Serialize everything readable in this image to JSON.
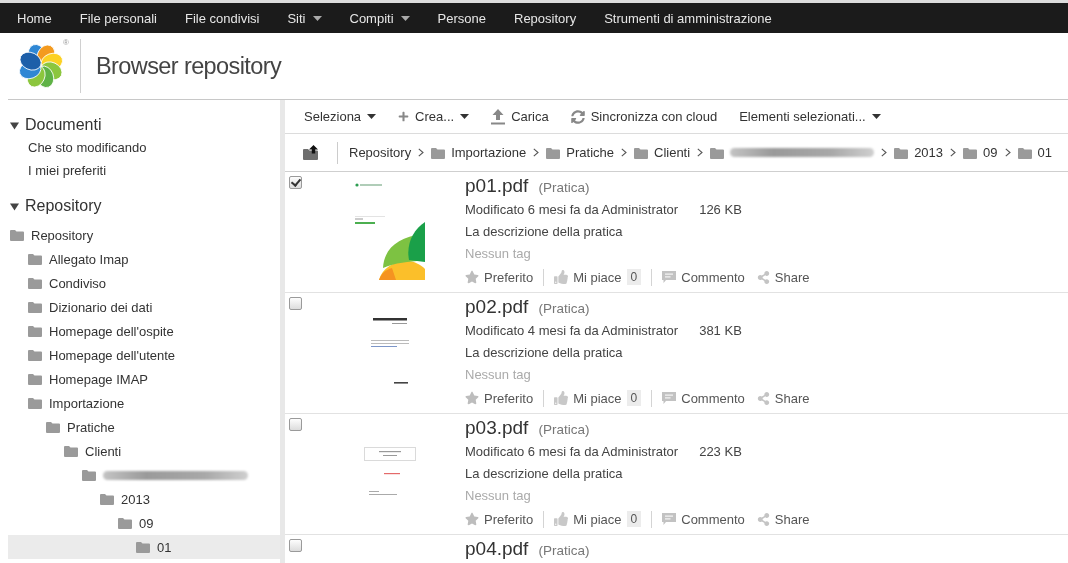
{
  "nav": {
    "items": [
      {
        "label": "Home",
        "dropdown": false
      },
      {
        "label": "File personali",
        "dropdown": false
      },
      {
        "label": "File condivisi",
        "dropdown": false
      },
      {
        "label": "Siti",
        "dropdown": true
      },
      {
        "label": "Compiti",
        "dropdown": true
      },
      {
        "label": "Persone",
        "dropdown": false
      },
      {
        "label": "Repository",
        "dropdown": false
      },
      {
        "label": "Strumenti di amministrazione",
        "dropdown": false
      }
    ]
  },
  "header": {
    "logo_mark": "®",
    "title": "Browser repository"
  },
  "sidebar": {
    "documents": {
      "title": "Documenti",
      "expanded": true,
      "links": [
        {
          "label": "Che sto modificando"
        },
        {
          "label": "I miei preferiti"
        }
      ]
    },
    "repository": {
      "title": "Repository",
      "expanded": true,
      "tree": [
        {
          "kind": "folder",
          "label": "Repository",
          "selected": false,
          "children": [
            {
              "kind": "folder",
              "label": "Allegato Imap",
              "selected": false
            },
            {
              "kind": "folder",
              "label": "Condiviso",
              "selected": false
            },
            {
              "kind": "folder",
              "label": "Dizionario dei dati",
              "selected": false
            },
            {
              "kind": "folder",
              "label": "Homepage dell'ospite",
              "selected": false
            },
            {
              "kind": "folder",
              "label": "Homepage dell'utente",
              "selected": false
            },
            {
              "kind": "folder",
              "label": "Homepage IMAP",
              "selected": false
            },
            {
              "kind": "folder",
              "label": "Importazione",
              "selected": false,
              "children": [
                {
                  "kind": "folder",
                  "label": "Pratiche",
                  "selected": false,
                  "children": [
                    {
                      "kind": "folder",
                      "label": "Clienti",
                      "selected": false,
                      "children": [
                        {
                          "kind": "redacted",
                          "selected": false,
                          "children": [
                            {
                              "kind": "folder",
                              "label": "2013",
                              "selected": false,
                              "children": [
                                {
                                  "kind": "folder",
                                  "label": "09",
                                  "selected": false,
                                  "children": [
                                    {
                                      "kind": "folder",
                                      "label": "01",
                                      "selected": true
                                    }
                                  ]
                                }
                              ]
                            }
                          ]
                        }
                      ]
                    }
                  ]
                }
              ]
            }
          ]
        }
      ]
    }
  },
  "toolbar": [
    {
      "kind": "menu",
      "label": "Seleziona"
    },
    {
      "kind": "create",
      "label": "Crea..."
    },
    {
      "kind": "upload",
      "label": "Carica"
    },
    {
      "kind": "sync",
      "label": "Sincronizza con cloud"
    },
    {
      "kind": "menu",
      "label": "Elementi selezionati..."
    }
  ],
  "breadcrumb": [
    {
      "kind": "root",
      "label": "Repository"
    },
    {
      "kind": "folder",
      "label": "Importazione"
    },
    {
      "kind": "folder",
      "label": "Pratiche"
    },
    {
      "kind": "folder",
      "label": "Clienti"
    },
    {
      "kind": "redacted"
    },
    {
      "kind": "folder",
      "label": "2013"
    },
    {
      "kind": "folder",
      "label": "09"
    },
    {
      "kind": "folder",
      "label": "01"
    }
  ],
  "documents": [
    {
      "checked": true,
      "thumbnail": {
        "kind": "leaves"
      },
      "name": "p01.pdf",
      "type": "(Pratica)",
      "modified": "Modificato 6 mesi fa da Administrator",
      "size": "126 KB",
      "description": "La descrizione della pratica",
      "tags": "Nessun tag",
      "favorite": false,
      "liked": false,
      "actions": {
        "favorite": "Preferito",
        "like": "Mi piace",
        "likes": "0",
        "comment": "Commento",
        "share": "Share"
      }
    },
    {
      "checked": false,
      "thumbnail": {
        "kind": "guide"
      },
      "name": "p02.pdf",
      "type": "(Pratica)",
      "modified": "Modificato 4 mesi fa da Administrator",
      "size": "381 KB",
      "description": "La descrizione della pratica",
      "tags": "Nessun tag",
      "favorite": false,
      "liked": false,
      "actions": {
        "favorite": "Preferito",
        "like": "Mi piace",
        "likes": "0",
        "comment": "Commento",
        "share": "Share"
      }
    },
    {
      "checked": false,
      "thumbnail": {
        "kind": "title-box"
      },
      "name": "p03.pdf",
      "type": "(Pratica)",
      "modified": "Modificato 6 mesi fa da Administrator",
      "size": "223 KB",
      "description": "La descrizione della pratica",
      "tags": "Nessun tag",
      "favorite": false,
      "liked": false,
      "actions": {
        "favorite": "Preferito",
        "like": "Mi piace",
        "likes": "0",
        "comment": "Commento",
        "share": "Share"
      }
    },
    {
      "checked": false,
      "name": "p04.pdf",
      "type": "(Pratica)"
    }
  ]
}
